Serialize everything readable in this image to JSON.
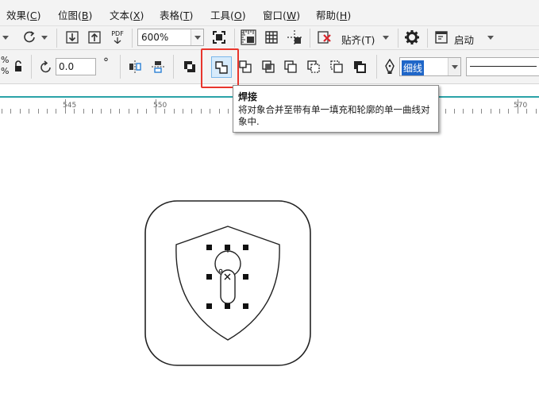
{
  "menu": [
    {
      "label": "效果",
      "key": "C"
    },
    {
      "label": "位图",
      "key": "B"
    },
    {
      "label": "文本",
      "key": "X"
    },
    {
      "label": "表格",
      "key": "T"
    },
    {
      "label": "工具",
      "key": "O"
    },
    {
      "label": "窗口",
      "key": "W"
    },
    {
      "label": "帮助",
      "key": "H"
    }
  ],
  "toolbar": {
    "pdf_label": "PDF",
    "zoom_value": "600%",
    "snap_label": "贴齐(T)",
    "launch_label": "启动"
  },
  "propbar": {
    "percent_top": "%",
    "percent_bottom": "%",
    "rotation_value": "0.0",
    "degree_symbol": "°",
    "outline_width": "细线"
  },
  "ruler": {
    "labels": [
      "545",
      "550",
      "570"
    ]
  },
  "tooltip": {
    "title": "焊接",
    "description": "将对象合并至带有单一填充和轮廓的单一曲线对象中."
  },
  "colors": {
    "highlight": "#e8352c",
    "ruler_accent": "#2aa3a8",
    "selection_blue": "#1f66c8"
  }
}
